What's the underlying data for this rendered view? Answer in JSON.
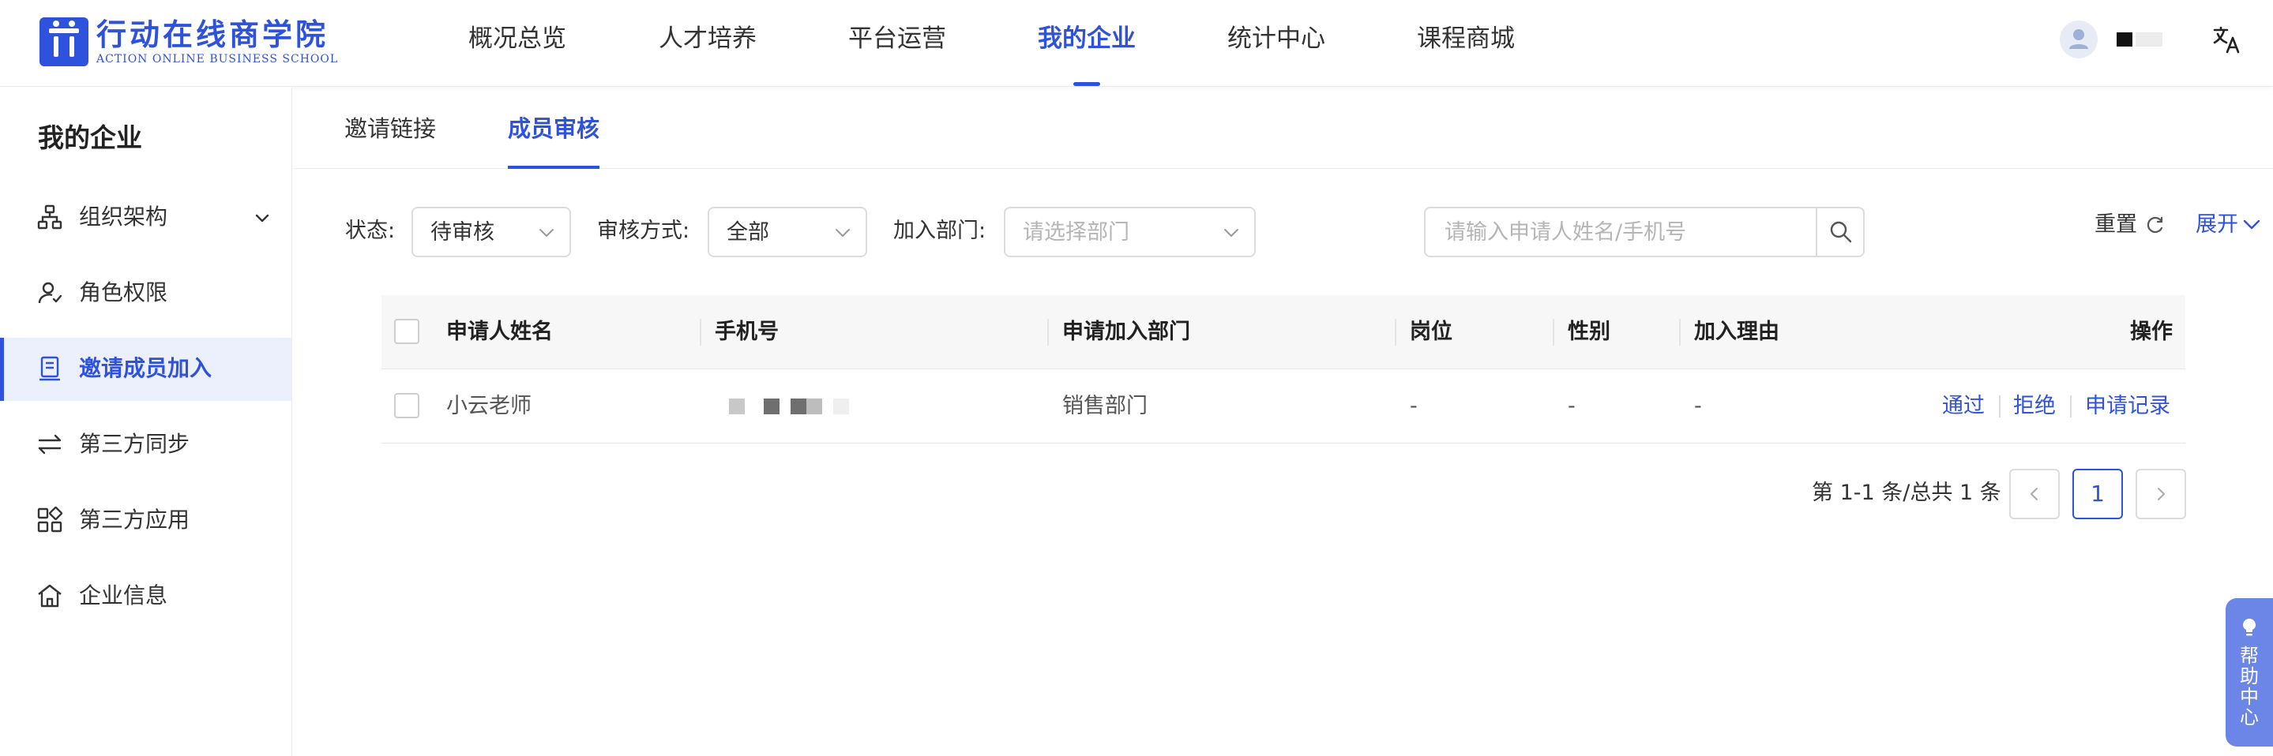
{
  "brand": {
    "name_cn": "行动在线商学院",
    "name_en": "ACTION ONLINE BUSINESS SCHOOL",
    "color": "#2f52dc"
  },
  "header": {
    "nav": [
      "概况总览",
      "人才培养",
      "平台运营",
      "我的企业",
      "统计中心",
      "课程商城"
    ],
    "active_nav": "我的企业",
    "icons": [
      "avatar-icon",
      "translate-icon"
    ]
  },
  "sidebar": {
    "title": "我的企业",
    "items": [
      {
        "label": "组织架构",
        "icon": "org-chart-icon",
        "has_submenu": true
      },
      {
        "label": "角色权限",
        "icon": "user-role-icon"
      },
      {
        "label": "邀请成员加入",
        "icon": "document-icon",
        "active": true
      },
      {
        "label": "第三方同步",
        "icon": "sync-arrows-icon"
      },
      {
        "label": "第三方应用",
        "icon": "apps-grid-icon"
      },
      {
        "label": "企业信息",
        "icon": "home-icon"
      }
    ]
  },
  "tabs": {
    "items": [
      "邀请链接",
      "成员审核"
    ],
    "active": "成员审核"
  },
  "filters": {
    "status": {
      "label": "状态:",
      "value": "待审核"
    },
    "method": {
      "label": "审核方式:",
      "value": "全部"
    },
    "department": {
      "label": "加入部门:",
      "placeholder": "请选择部门"
    },
    "search": {
      "placeholder": "请输入申请人姓名/手机号",
      "value": ""
    },
    "reset_label": "重置",
    "expand_label": "展开"
  },
  "table": {
    "columns": [
      "申请人姓名",
      "手机号",
      "申请加入部门",
      "岗位",
      "性别",
      "加入理由",
      "操作"
    ],
    "rows": [
      {
        "name": "小云老师",
        "phone": "",
        "department": "销售部门",
        "position": "-",
        "gender": "-",
        "reason": "-",
        "actions": [
          "通过",
          "拒绝",
          "申请记录"
        ]
      }
    ]
  },
  "pagination": {
    "summary": "第 1-1 条/总共 1 条",
    "current": "1"
  },
  "help": {
    "label": "帮助中心",
    "icon": "lightbulb-icon"
  }
}
